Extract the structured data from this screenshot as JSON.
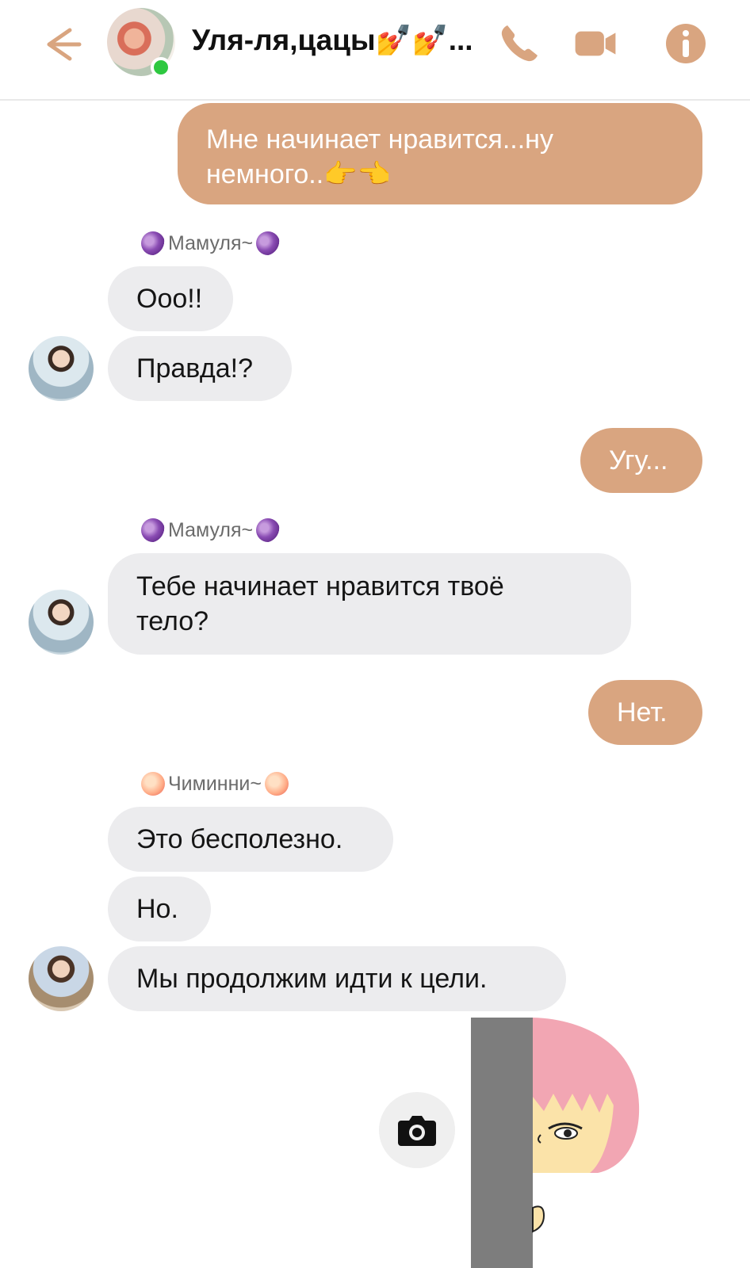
{
  "header": {
    "title": "Уля-ля,цацы💅💅...",
    "icons": [
      "back-arrow-icon",
      "phone-icon",
      "video-camera-icon",
      "info-icon"
    ],
    "accent_color": "#d9a580",
    "online_color": "#2ec840"
  },
  "messages": [
    {
      "dir": "out",
      "text": "Мне начинает нравится...ну\nнемного..👉👈"
    },
    {
      "dir": "sender",
      "text": "Мамуля~"
    },
    {
      "dir": "in",
      "text": "Ооо!!"
    },
    {
      "dir": "in",
      "text": "Правда!?"
    },
    {
      "dir": "out",
      "text": "Угу..."
    },
    {
      "dir": "sender",
      "text": "Мамуля~"
    },
    {
      "dir": "in",
      "text": "Тебе начинает нравится твоё\nтело?"
    },
    {
      "dir": "out",
      "text": "Нет."
    },
    {
      "dir": "sender",
      "text": "Чиминни~"
    },
    {
      "dir": "in",
      "text": "Это бесполезно."
    },
    {
      "dir": "in",
      "text": "Но."
    },
    {
      "dir": "in",
      "text": "Мы продолжим идти к цели."
    }
  ],
  "composer": {
    "camera_icon": "camera-icon",
    "sticker": "peeking-girl-sticker"
  }
}
